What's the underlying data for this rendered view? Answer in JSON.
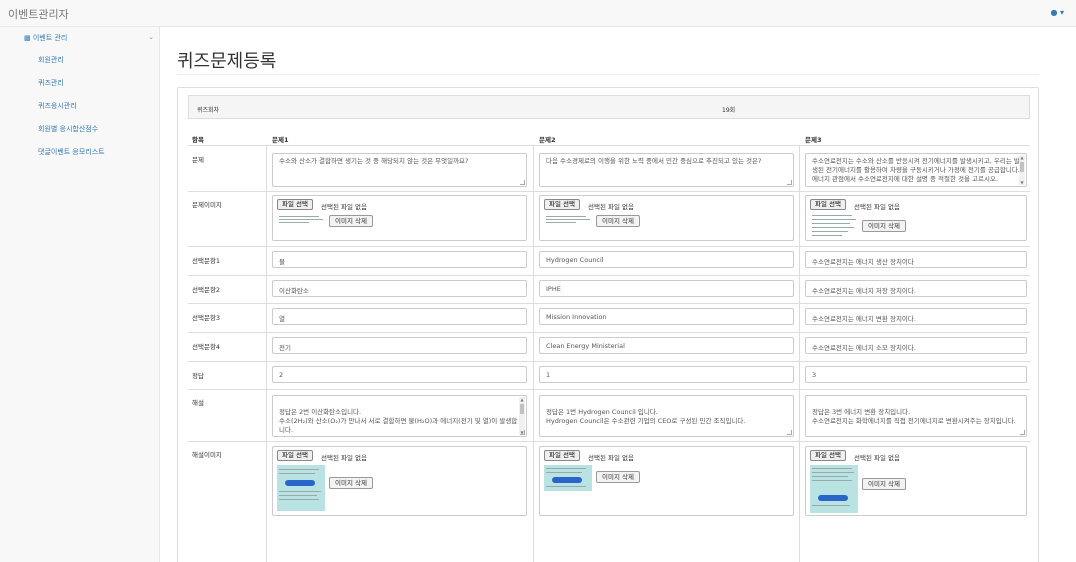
{
  "app": {
    "title": "이벤트관리자",
    "user_icon": "user-icon"
  },
  "sidebar": {
    "section_label": "이벤트 관리",
    "section_icon": "bar-chart-icon",
    "items": [
      {
        "label": "회원관리"
      },
      {
        "label": "퀴즈관리"
      },
      {
        "label": "퀴즈응시관리"
      },
      {
        "label": "회원별 응시합산점수"
      },
      {
        "label": "댓글이벤트 응모리스트"
      }
    ]
  },
  "page": {
    "title": "퀴즈문제등록"
  },
  "round": {
    "label": "퀴즈회차",
    "value": "19회"
  },
  "table": {
    "headers": {
      "item": "항목",
      "q1": "문제1",
      "q2": "문제2",
      "q3": "문제3"
    },
    "row_labels": {
      "question": "문제",
      "question_image": "문제이미지",
      "choice1": "선택문항1",
      "choice2": "선택문항2",
      "choice3": "선택문항3",
      "choice4": "선택문항4",
      "answer": "정답",
      "explanation": "해설",
      "explanation_image": "해설이미지"
    },
    "file_button": "파일 선택",
    "file_none": "선택된 파일 없음",
    "delete_image": "이미지 삭제",
    "questions": [
      {
        "question": "수소와 산소가 결합하면 생기는 것 중 해당되지 않는 것은 무엇일까요?",
        "choices": [
          "물",
          "이산화탄소",
          "열",
          "전기"
        ],
        "answer": "2",
        "explanation": "정답은 2번 이산화탄소입니다.\n수소(2H₂)와 산소(O₂)가 만나서 서로 결합하면 물(H₂O)과 에너지(전기 및 열)이 발생합니다."
      },
      {
        "question": "다음 수소경제로의 이행을 위한 노력 중에서 민간 중심으로 추진되고 있는 것은?",
        "choices": [
          "Hydrogen Council",
          "IPHE",
          "Mission Innovation",
          "Clean Energy Ministerial"
        ],
        "answer": "1",
        "explanation": "정답은 1번 Hydrogen Council 입니다.\nHydrogen Council은 수소관련 기업의 CEO로 구성된 민간 조직입니다."
      },
      {
        "question": "수소연료전지는 수소와 산소를 반응시켜 전기에너지를 발생시키고, 우리는 발생된 전기에너지를 활용하여 차량을 구동시키거나 가정에 전기를 공급합니다. 에너지 관점에서 수소연료전지에 대한 설명 중 적절한 것을 고르시오.",
        "choices": [
          "수소연료전지는 에너지 생산 장치이다",
          "수소연료전지는 에너지 저장 장치이다.",
          "수소연료전지는 에너지 변환 장치이다.",
          "수소연료전지는 에너지 소모 장치이다."
        ],
        "answer": "3",
        "explanation": "정답은 3번 에너지 변환 장치입니다.\n수소연료전지는 화학에너지를 직접 전기에너지로 변환시켜주는 장치입니다."
      }
    ]
  }
}
